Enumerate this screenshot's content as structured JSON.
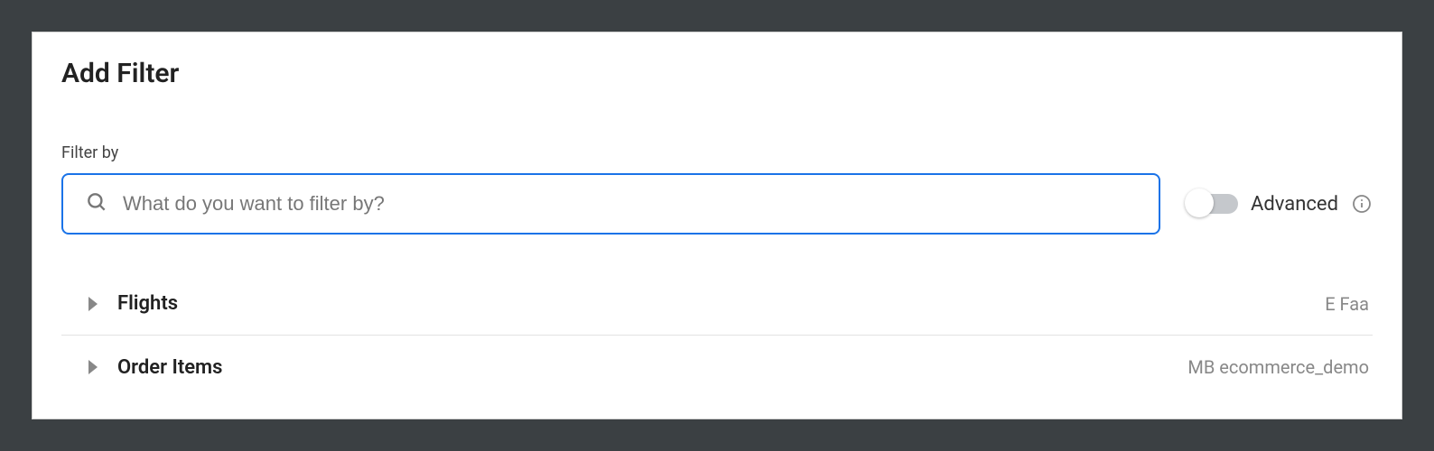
{
  "title": "Add Filter",
  "filter": {
    "label": "Filter by",
    "placeholder": "What do you want to filter by?",
    "value": ""
  },
  "advanced": {
    "label": "Advanced",
    "enabled": false
  },
  "items": [
    {
      "name": "Flights",
      "meta": "E Faa"
    },
    {
      "name": "Order Items",
      "meta": "MB ecommerce_demo"
    }
  ]
}
